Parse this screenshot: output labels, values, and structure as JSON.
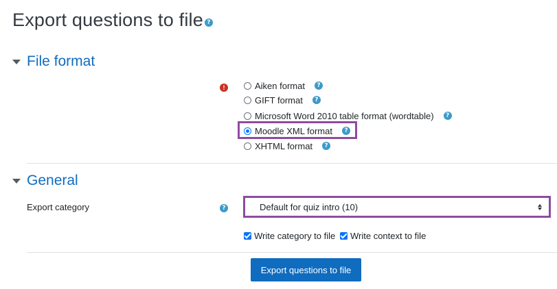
{
  "page": {
    "title": "Export questions to file",
    "help_glyph": "?"
  },
  "file_format": {
    "section_title": "File format",
    "required_glyph": "!",
    "options": [
      {
        "label": "Aiken format",
        "checked": false
      },
      {
        "label": "GIFT format",
        "checked": false
      },
      {
        "label": "Microsoft Word 2010 table format (wordtable)",
        "checked": false
      },
      {
        "label": "Moodle XML format",
        "checked": true
      },
      {
        "label": "XHTML format",
        "checked": false
      }
    ]
  },
  "general": {
    "section_title": "General",
    "export_category_label": "Export category",
    "category_selected": "Default for quiz intro (10)",
    "write_category_label": "Write category to file",
    "write_context_label": "Write context to file"
  },
  "submit": {
    "label": "Export questions to file"
  },
  "colors": {
    "link_blue": "#0f6cbf",
    "help_blue": "#3d9ac9",
    "required_red": "#ca3120",
    "highlight_purple": "#8e4b9f",
    "checkbox_blue": "#0075ff"
  }
}
